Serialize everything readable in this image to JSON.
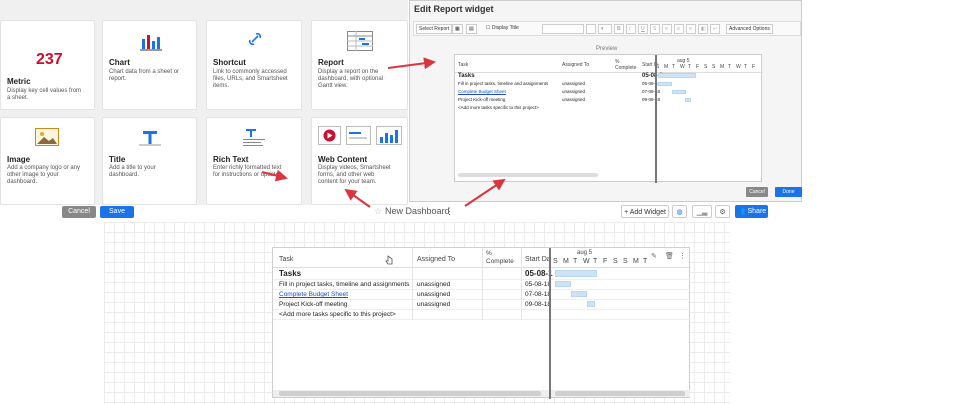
{
  "widget_gallery": {
    "cards": [
      {
        "title": "Metric",
        "desc": [
          "Display key cell values from",
          "a sheet."
        ],
        "value": "237"
      },
      {
        "title": "Chart",
        "desc": [
          "Chart data from a sheet or",
          "report."
        ]
      },
      {
        "title": "Shortcut",
        "desc": [
          "Link to commonly accessed",
          "files, URLs, and Smartsheet",
          "items."
        ]
      },
      {
        "title": "Report",
        "desc": [
          "Display a report on the",
          "dashboard, with optional",
          "Gantt view."
        ]
      },
      {
        "title": "Image",
        "desc": [
          "Add a company logo or any",
          "other image to your",
          "dashboard."
        ]
      },
      {
        "title": "Title",
        "desc": [
          "Add a title to your",
          "dashboard."
        ]
      },
      {
        "title": "Rich Text",
        "desc": [
          "Enter richly formatted text",
          "for instructions or updates."
        ]
      },
      {
        "title": "Web Content",
        "desc": [
          "Display videos, Smartsheet",
          "forms, and other web",
          "content for your team."
        ]
      }
    ]
  },
  "edit_widget": {
    "title": "Edit Report widget",
    "select_report": "Select Report",
    "display_title": "Display Title",
    "advanced": "Advanced Options",
    "preview": "Preview",
    "cancel": "Cancel",
    "done": "Done"
  },
  "toolbar": {
    "cancel": "Cancel",
    "save": "Save",
    "dashboard_name": "New Dashboard",
    "add_widget": "+ Add Widget",
    "share": "Share"
  },
  "report": {
    "col_task": "Task",
    "col_assigned": "Assigned To",
    "col_complete_1": "%",
    "col_complete_2": "Complete",
    "col_start": "Start Da",
    "col_start_small": "Start D",
    "week": "aug 5",
    "days": [
      "S",
      "M",
      "T",
      "W",
      "T",
      "F",
      "S",
      "S",
      "M",
      "T"
    ],
    "days_small": [
      "S",
      "M",
      "T",
      "W",
      "T",
      "F",
      "S",
      "S",
      "M",
      "T",
      "W",
      "T",
      "F"
    ],
    "rows": [
      {
        "task": "Tasks",
        "assigned": "",
        "start": "05-08-1",
        "style": "bold"
      },
      {
        "task": "Fill in project tasks, timeline and assignments",
        "assigned": "unassigned",
        "start": "05-08-18",
        "style": ""
      },
      {
        "task": "Complete Budget Sheet",
        "assigned": "unassigned",
        "start": "07-08-18",
        "style": "link"
      },
      {
        "task": "Project Kick-off meeting",
        "assigned": "unassigned",
        "start": "09-08-18",
        "style": ""
      },
      {
        "task": "<Add more tasks specific to this project>",
        "assigned": "",
        "start": "",
        "style": ""
      }
    ],
    "gantt": [
      0.05,
      0.4
    ]
  },
  "colors": {
    "accent": "#1a73e8",
    "arrow": "#d9363e",
    "metric": "#c8102e"
  }
}
